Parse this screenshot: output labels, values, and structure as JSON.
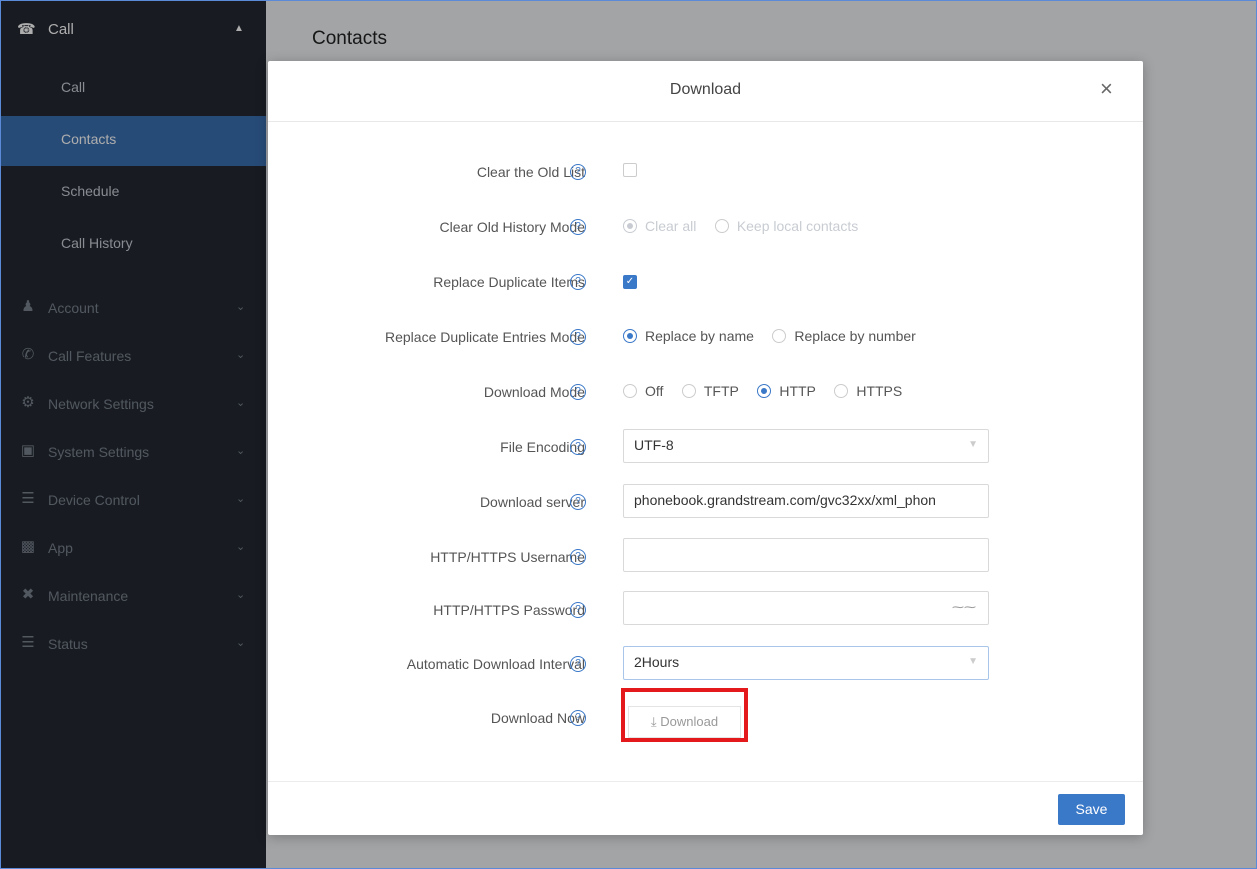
{
  "sidebar": {
    "top": {
      "label": "Call",
      "icon": "phone-icon"
    },
    "sub_items": [
      {
        "label": "Call"
      },
      {
        "label": "Contacts"
      },
      {
        "label": "Schedule"
      },
      {
        "label": "Call History"
      }
    ],
    "groups": [
      {
        "label": "Account",
        "icon": "person-icon"
      },
      {
        "label": "Call Features",
        "icon": "phone-icon"
      },
      {
        "label": "Network Settings",
        "icon": "network-icon"
      },
      {
        "label": "System Settings",
        "icon": "system-icon"
      },
      {
        "label": "Device Control",
        "icon": "list-icon"
      },
      {
        "label": "App",
        "icon": "app-icon"
      },
      {
        "label": "Maintenance",
        "icon": "tools-icon"
      },
      {
        "label": "Status",
        "icon": "list-icon"
      }
    ]
  },
  "main": {
    "title": "Contacts"
  },
  "modal": {
    "title": "Download",
    "close": "×",
    "fields": {
      "clear_old_list": {
        "label": "Clear the Old List"
      },
      "clear_old_history_mode": {
        "label": "Clear Old History Mode",
        "options": [
          "Clear all",
          "Keep local contacts"
        ],
        "selected": "Clear all"
      },
      "replace_duplicate_items": {
        "label": "Replace Duplicate Items"
      },
      "replace_duplicate_entries_mode": {
        "label": "Replace Duplicate Entries Mode",
        "options": [
          "Replace by name",
          "Replace by number"
        ],
        "selected": "Replace by name"
      },
      "download_mode": {
        "label": "Download Mode",
        "options": [
          "Off",
          "TFTP",
          "HTTP",
          "HTTPS"
        ],
        "selected": "HTTP"
      },
      "file_encoding": {
        "label": "File Encoding",
        "value": "UTF-8"
      },
      "download_server": {
        "label": "Download server",
        "value": "phonebook.grandstream.com/gvc32xx/xml_phon"
      },
      "http_username": {
        "label": "HTTP/HTTPS Username",
        "value": ""
      },
      "http_password": {
        "label": "HTTP/HTTPS Password",
        "value": ""
      },
      "auto_interval": {
        "label": "Automatic Download Interval",
        "value": "2Hours"
      },
      "download_now": {
        "label": "Download Now",
        "button": "Download"
      }
    },
    "save": "Save"
  },
  "colors": {
    "accent": "#3a78c8",
    "sidebar": "#242a33",
    "highlight": "#e3191b"
  }
}
